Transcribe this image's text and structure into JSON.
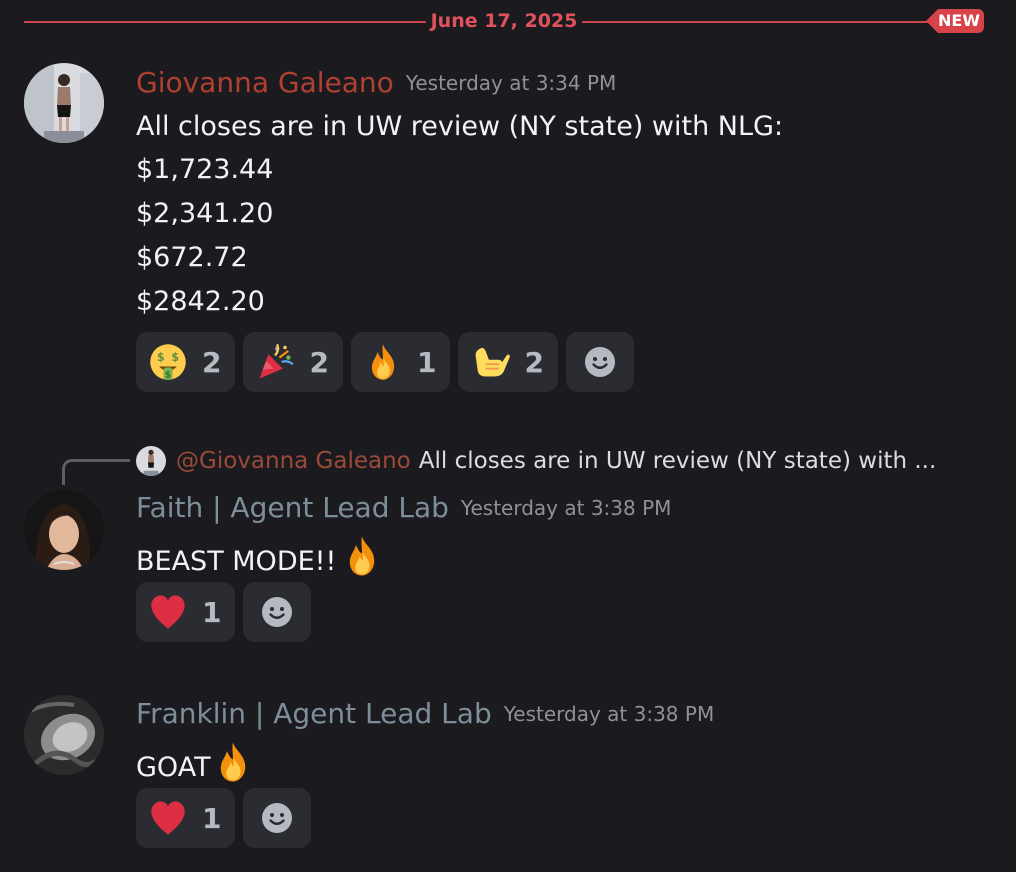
{
  "divider": {
    "date": "June 17, 2025",
    "new_label": "NEW"
  },
  "colors": {
    "accent_red": "#e0525b",
    "giovanna_name": "#b0402f",
    "agent_lead_lab_name": "#7d8e99",
    "background": "#1b1b1f",
    "reaction_bg": "#2b2c31"
  },
  "messages": [
    {
      "author": "Giovanna Galeano",
      "timestamp": "Yesterday at 3:34 PM",
      "lines": [
        "All closes are in UW review (NY state) with NLG:",
        "$1,723.44",
        "$2,341.20",
        "$672.72",
        "$2842.20"
      ],
      "reactions": [
        {
          "emoji": "money-mouth-face-icon",
          "count": "2"
        },
        {
          "emoji": "party-popper-icon",
          "count": "2"
        },
        {
          "emoji": "fire-icon",
          "count": "1"
        },
        {
          "emoji": "call-me-hand-icon",
          "count": "2"
        }
      ]
    },
    {
      "reply_to": {
        "mention": "@Giovanna Galeano",
        "preview": "All closes are in UW review (NY state) with ..."
      },
      "author": "Faith | Agent Lead Lab",
      "timestamp": "Yesterday at 3:38 PM",
      "text": "BEAST MODE!!",
      "text_emoji": "fire-icon",
      "reactions": [
        {
          "emoji": "red-heart-icon",
          "count": "1"
        }
      ]
    },
    {
      "author": "Franklin | Agent Lead Lab",
      "timestamp": "Yesterday at 3:38 PM",
      "text": "GOAT",
      "text_emoji": "fire-icon",
      "reactions": [
        {
          "emoji": "red-heart-icon",
          "count": "1"
        }
      ]
    }
  ]
}
